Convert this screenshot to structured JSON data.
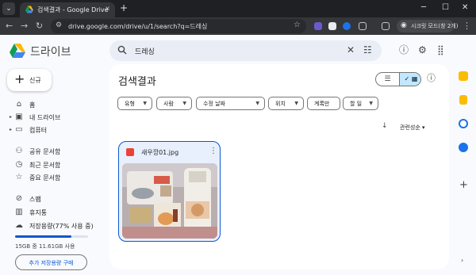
{
  "browser": {
    "tab_title": "검색결과 - Google Drive",
    "tab_close": "×",
    "new_tab": "+",
    "url": "drive.google.com/drive/u/1/search?q=드레싱",
    "profile_label": "시크릿 모드(창 2개)",
    "window_controls": {
      "minimize": "─",
      "maximize": "☐",
      "close": "✕"
    },
    "nav": {
      "back": "←",
      "forward": "→",
      "reload": "↻"
    }
  },
  "app": {
    "title": "드라이브"
  },
  "search": {
    "value": "드레싱",
    "clear": "✕",
    "tune": "☷"
  },
  "header_icons": [
    "help-icon",
    "settings-icon",
    "apps-icon"
  ],
  "sidebar": {
    "new_label": "신규",
    "items": [
      {
        "label": "홈",
        "icon": "home-icon",
        "expandable": false
      },
      {
        "label": "내 드라이브",
        "icon": "drive-icon",
        "expandable": true
      },
      {
        "label": "컴퓨터",
        "icon": "computer-icon",
        "expandable": true
      },
      {
        "label": "공유 문서함",
        "icon": "shared-icon",
        "expandable": false
      },
      {
        "label": "최근 문서함",
        "icon": "clock-icon",
        "expandable": false
      },
      {
        "label": "중요 문서함",
        "icon": "star-icon",
        "expandable": false
      },
      {
        "label": "스팸",
        "icon": "spam-icon",
        "expandable": false
      },
      {
        "label": "휴지통",
        "icon": "trash-icon",
        "expandable": false
      },
      {
        "label": "저장용량(77% 사용 중)",
        "icon": "cloud-icon",
        "expandable": false
      }
    ],
    "storage_used_fraction": 0.77,
    "storage_text": "15GB 중 11.61GB 사용",
    "buy_storage_label": "추가 저장용량 구매"
  },
  "main": {
    "title": "검색결과",
    "filters": [
      {
        "label": "유형",
        "dropdown": true
      },
      {
        "label": "사람",
        "dropdown": true
      },
      {
        "label": "수정 날짜",
        "dropdown": true
      },
      {
        "label": "위치",
        "dropdown": true
      },
      {
        "label": "계록만",
        "dropdown": false
      },
      {
        "label": "할 일",
        "dropdown": true
      }
    ],
    "sort_label": "관련성순",
    "files": [
      {
        "name": "새우깡01.jpg",
        "type": "image"
      }
    ]
  },
  "colors": {
    "accent": "#0b57d0",
    "selected_view": "#c2e7ff",
    "card_selected_bg": "#e8f0fe",
    "image_type_red": "#ea4335"
  }
}
